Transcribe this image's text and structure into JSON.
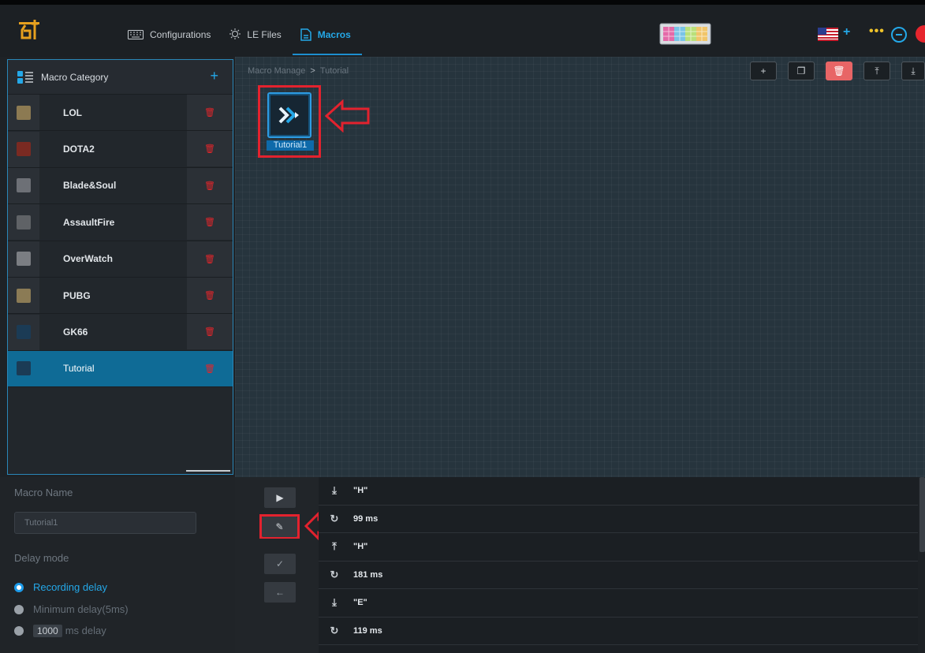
{
  "app": {
    "logo_glyph": "6†",
    "brand_color": "#24a8e8"
  },
  "nav": {
    "tabs": [
      {
        "label": "Configurations",
        "icon": "keyboard-icon"
      },
      {
        "label": "LE Files",
        "icon": "lightbulb-icon"
      },
      {
        "label": "Macros",
        "icon": "document-icon",
        "active": true
      }
    ],
    "more": "•••"
  },
  "sidebar": {
    "title": "Macro Category",
    "add_label": "+",
    "delete_glyph": "🗑",
    "items": [
      {
        "label": "LOL",
        "thumb_color": "#8c7a52"
      },
      {
        "label": "DOTA2",
        "thumb_color": "#7a2a22"
      },
      {
        "label": "Blade&Soul",
        "thumb_color": "#6d7076"
      },
      {
        "label": "AssaultFire",
        "thumb_color": "#5f6266"
      },
      {
        "label": "OverWatch",
        "thumb_color": "#7b7e83"
      },
      {
        "label": "PUBG",
        "thumb_color": "#8b7b55"
      },
      {
        "label": "GK66",
        "thumb_color": "#1b3b55"
      },
      {
        "label": "Tutorial",
        "thumb_color": "#1b3b55",
        "active": true
      }
    ]
  },
  "main": {
    "breadcrumb": {
      "root": "Macro Manage",
      "sep": ">",
      "current": "Tutorial"
    },
    "toolbar": {
      "add": "+",
      "copy": "❐",
      "delete": "🗑",
      "export": "⤒",
      "import": "⤓"
    },
    "macro": {
      "label": "Tutorial1"
    }
  },
  "bottom": {
    "macro_name_label": "Macro Name",
    "macro_name_value": "Tutorial1",
    "delay_mode_label": "Delay mode",
    "delay_options": {
      "recording": "Recording delay",
      "minimum": "Minimum delay(5ms)",
      "fixed_value": "1000",
      "fixed_suffix": "ms delay"
    },
    "controls": {
      "play": "▶",
      "edit": "✎",
      "confirm": "✓",
      "back": "←"
    },
    "events": [
      {
        "icon": "key-down-icon",
        "glyph": "⤓",
        "text": "\"H\""
      },
      {
        "icon": "delay-icon",
        "glyph": "↻",
        "text": "99 ms"
      },
      {
        "icon": "key-up-icon",
        "glyph": "⤒",
        "text": "\"H\""
      },
      {
        "icon": "delay-icon",
        "glyph": "↻",
        "text": "181 ms"
      },
      {
        "icon": "key-down-icon",
        "glyph": "⤓",
        "text": "\"E\""
      },
      {
        "icon": "delay-icon",
        "glyph": "↻",
        "text": "119 ms"
      }
    ]
  }
}
